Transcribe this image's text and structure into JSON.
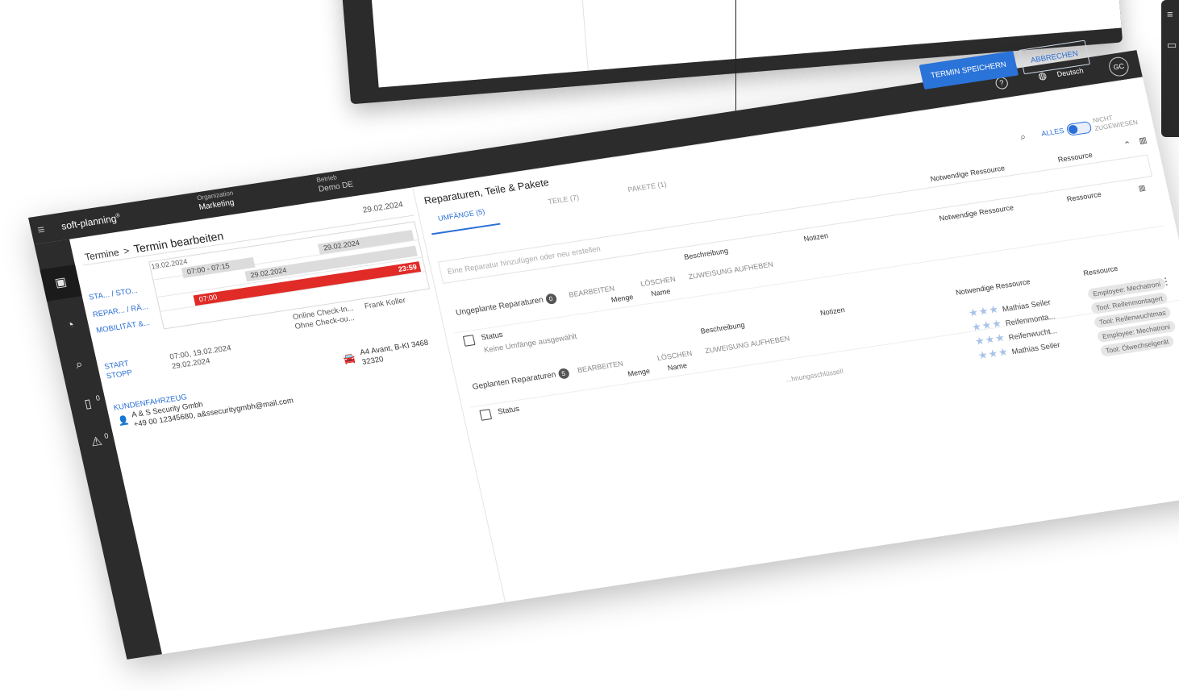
{
  "header": {
    "brand": "soft-planning",
    "brand_sup": "®",
    "org_label": "Organization",
    "org_value": "Marketing",
    "site_label": "Betrieb",
    "site_value": "Demo DE",
    "help": "?",
    "language": "Deutsch",
    "user_initials": "GC"
  },
  "actions": {
    "save": "TERMIN SPEICHERN",
    "cancel": "ABBRECHEN"
  },
  "sidebar": {
    "icons": [
      "calendar-icon",
      "speedometer-icon",
      "search-icon",
      "device-icon",
      "warning-icon"
    ],
    "badges": {
      "device": "0",
      "warning": "0"
    }
  },
  "breadcrumb": {
    "parent": "Termine",
    "separator": ">",
    "current": "Termin bearbeiten"
  },
  "detail": {
    "date_right": "29.02.2024",
    "gantt_labels": [
      "STA... / STO...",
      "REPAR... / RÄ...",
      "MOBILITÄT &..."
    ],
    "gantt_date_left": "19.02.2024",
    "slot_time": "07:00 - 07:15",
    "bar1_date": "29.02.2024",
    "bar2_date": "29.02.2024",
    "red_start": "07:00",
    "red_end": "23:59",
    "checkin_online": "Online Check-In...",
    "checkin_person": "Frank Koller",
    "checkout": "Ohne Check-ou...",
    "start_label": "START",
    "stop_label": "STOPP",
    "start_value": "07:00, 19.02.2024",
    "stop_value": "29.02.2024",
    "vehicle_model": "A4 Avant, B-KI 3468",
    "vehicle_code": "32320",
    "customer_label": "KUNDENFAHRZEUG",
    "customer_name": "A & S Security Gmbh",
    "customer_contact": "+49 00 12345680, a&ssecuritygmbh@mail.com"
  },
  "main": {
    "title": "Reparaturen, Teile & Pakete",
    "tabs": [
      "UMFÄNGE (5)",
      "TEILE (7)",
      "PAKETE (1)"
    ],
    "filter_all": "ALLES",
    "filter_unassigned": "NICHT ZUGEWIESEN",
    "repair_placeholder": "Eine Reparatur hinzufügen oder neu erstellen",
    "columns": {
      "menge": "Menge",
      "name": "Name",
      "beschreibung": "Beschreibung",
      "notizen": "Notizen",
      "notwendige_ressource": "Notwendige Ressource",
      "ressource": "Ressource",
      "status": "Status"
    },
    "unplanned": {
      "title": "Ungeplante Reparaturen",
      "count": "0",
      "edit": "BEARBEITEN",
      "delete": "LÖSCHEN",
      "unassign": "ZUWEISUNG AUFHEBEN",
      "empty": "Keine Umfänge ausgewählt"
    },
    "planned": {
      "title": "Geplanten Reparaturen",
      "count": "5",
      "edit": "BEARBEITEN",
      "delete": "LÖSCHEN",
      "unassign": "ZUWEISUNG AUFHEBEN"
    },
    "employees": [
      {
        "name": "Mathias Seiler",
        "chip": "Employee: Mechatroni"
      },
      {
        "name": "Reifenmonta...",
        "chip": "Tool: Reifenmontagert"
      },
      {
        "name": "Reifenwucht...",
        "chip": "Tool: Reifenwuchtmas"
      },
      {
        "name": "Mathias Seiler",
        "chip": "Employee: Mechatroni"
      }
    ],
    "chip_extra": "Tool: Ölwechselgerät",
    "faint_text": "...hnungsschlüssel!"
  },
  "colors": {
    "accent": "#2a73d8",
    "danger": "#e02b27",
    "chrome": "#2c2c2c"
  }
}
